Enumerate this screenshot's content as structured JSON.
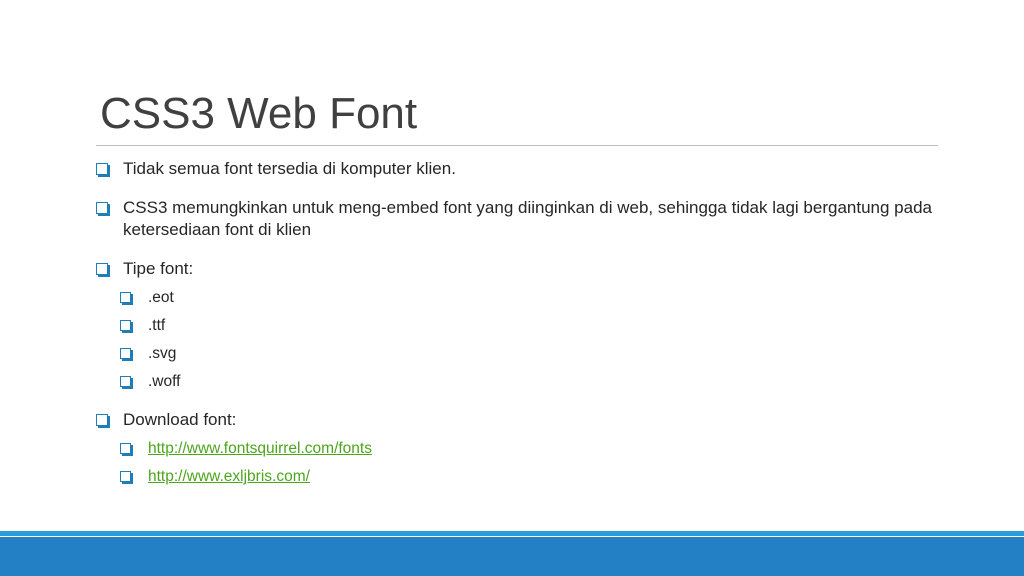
{
  "slide": {
    "title": "CSS3 Web Font",
    "bullets": [
      "Tidak semua font tersedia di komputer klien.",
      "CSS3 memungkinkan untuk meng-embed font yang diinginkan di web, sehingga tidak lagi bergantung pada ketersediaan font di klien",
      "Tipe font:",
      "Download font:"
    ],
    "font_types": [
      ".eot",
      ".ttf",
      ".svg",
      ".woff"
    ],
    "download_links": [
      "http://www.fontsquirrel.com/fonts",
      "http://www.exljbris.com/"
    ]
  },
  "colors": {
    "accent": "#2380c4",
    "link": "#4da51d",
    "bullet": "#1e7fb8"
  },
  "icons": {
    "bullet": "square-checkbox-bullet-icon"
  }
}
